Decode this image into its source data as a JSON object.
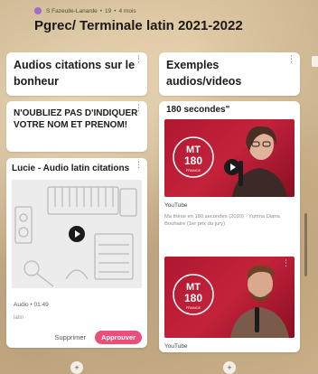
{
  "header": {
    "author": "S Fazeulle-Lanarde",
    "likes": "19",
    "time_ago": "4 mois",
    "title": "Pgrec/ Terminale latin 2021-2022"
  },
  "columns": [
    {
      "title": "Audios citations sur le bonheur",
      "note": "N'OUBLIEZ PAS D'INDIQUER VOTRE NOM ET PRENOM!",
      "post": {
        "title": "Lucie - Audio latin citations",
        "audio_meta": "Audio • 01:49",
        "subtitle": "latin",
        "delete_label": "Supprimer",
        "approve_label": "Approuver"
      }
    },
    {
      "title": "Exemples audios/videos",
      "post_heading": "180 secondes\"",
      "videos": [
        {
          "logo_line1": "MT",
          "logo_line2": "180",
          "logo_line3": "FRANCE",
          "source": "YouTube",
          "caption": "Ma thèse en 180 secondes (2020) - Yumna Diana Bouhaire (1er prix du jury)"
        },
        {
          "logo_line1": "MT",
          "logo_line2": "180",
          "logo_line3": "FRANCE",
          "source": "YouTube"
        }
      ]
    }
  ],
  "icons": {
    "menu": "⋮",
    "add": "+"
  },
  "colors": {
    "approve": "#ea4f7a",
    "video_red": "#c4223b"
  }
}
